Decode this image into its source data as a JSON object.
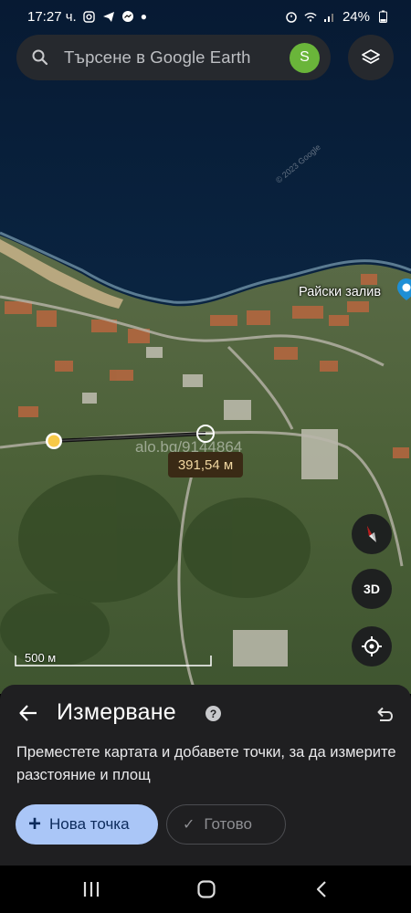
{
  "status_bar": {
    "time": "17:27 ч.",
    "battery": "24%",
    "notification_icons": [
      "instagram-icon",
      "telegram-icon",
      "messenger-icon",
      "dot-icon"
    ],
    "system_icons": [
      "alarm-icon",
      "wifi-icon",
      "signal-icon",
      "battery-icon"
    ]
  },
  "search": {
    "placeholder": "Търсене в Google Earth",
    "avatar_letter": "S",
    "avatar_color": "#6ab53a"
  },
  "map": {
    "place_label": "Райски залив",
    "watermark": "alo.bg/9144864",
    "distance": "391,54 м",
    "scale_label": "500 м",
    "copyright": "© 2023 Google",
    "three_d_label": "3D",
    "colors": {
      "sea": "#0b2846",
      "measure_line": "#1a1a1a",
      "start_point": "#f7c948"
    }
  },
  "sheet": {
    "title": "Измерване",
    "instructions": "Преместете картата и добавете точки, за да измерите разстояние и площ",
    "new_point_label": "Нова точка",
    "done_label": "Готово",
    "colors": {
      "primary_button": "#aac6f7",
      "sheet_bg": "#1f1f21"
    }
  }
}
